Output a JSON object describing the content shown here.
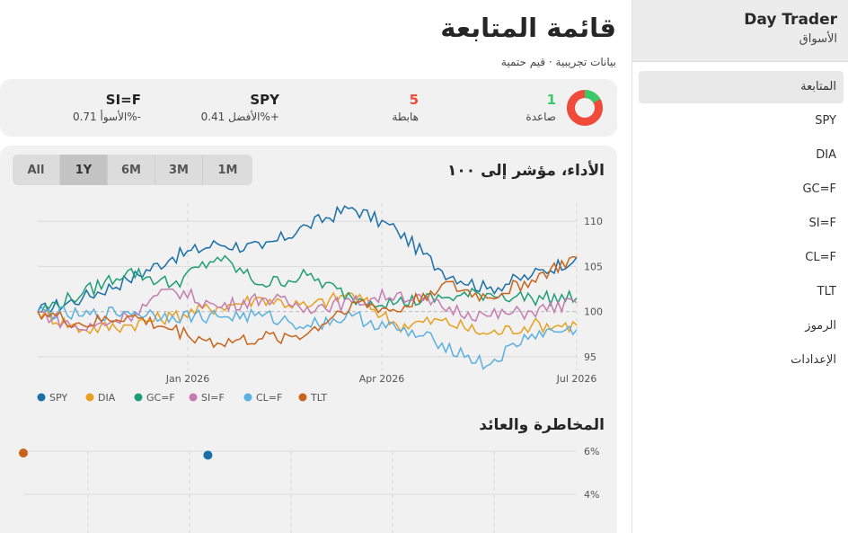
{
  "app": {
    "name": "Day Trader",
    "section": "الأسواق"
  },
  "nav": [
    {
      "label": "المتابعة",
      "active": true
    },
    {
      "label": "SPY"
    },
    {
      "label": "DIA"
    },
    {
      "label": "GC=F"
    },
    {
      "label": "SI=F"
    },
    {
      "label": "CL=F"
    },
    {
      "label": "TLT"
    },
    {
      "label": "الرموز"
    },
    {
      "label": "الإعدادات"
    }
  ],
  "page": {
    "title": "قائمة المتابعة",
    "subtitle": "بيانات تجريبية · قيم حتمية"
  },
  "summary": {
    "up": {
      "count": "1",
      "label": "صاعدة",
      "color": "#3cc96a"
    },
    "down": {
      "count": "5",
      "label": "هابطة",
      "color": "#f04a3a"
    },
    "best": {
      "symbol": "SPY",
      "label": "الأفضل 0.41%+"
    },
    "worst": {
      "symbol": "SI=F",
      "label": "الأسوأ 0.71%-"
    }
  },
  "performance": {
    "title": "الأداء، مؤشر إلى ١٠٠",
    "ranges": [
      "All",
      "1Y",
      "6M",
      "3M",
      "1M"
    ],
    "active_range": "1Y"
  },
  "risk": {
    "title": "المخاطرة والعائد",
    "y_ticks": [
      "6%",
      "4%"
    ]
  },
  "chart_data": [
    {
      "type": "line",
      "title": "الأداء، مؤشر إلى ١٠٠",
      "x_ticks": [
        "Jan 2026",
        "Apr 2026",
        "Jul 2026"
      ],
      "y_ticks": [
        95,
        100,
        105,
        110
      ],
      "ylim": [
        93.5,
        112
      ],
      "x": [
        "2025-07",
        "2025-08",
        "2025-09",
        "2025-10",
        "2025-11",
        "2025-12",
        "2026-01",
        "2026-02",
        "2026-03",
        "2026-04",
        "2026-05",
        "2026-06",
        "2026-07"
      ],
      "legend_position": "bottom-left",
      "series": [
        {
          "name": "SPY",
          "color": "#1a6fa8",
          "values": [
            100,
            101.5,
            103.5,
            106,
            107.5,
            107,
            109.5,
            111.5,
            109,
            104.5,
            102.5,
            104,
            106
          ]
        },
        {
          "name": "DIA",
          "color": "#e8a020",
          "values": [
            100,
            98,
            98.5,
            99.5,
            100.5,
            101.5,
            100.5,
            102,
            98.5,
            99,
            97.5,
            98.5,
            98.5
          ]
        },
        {
          "name": "GC=F",
          "color": "#1f9e76",
          "values": [
            100,
            102,
            104.5,
            103,
            106,
            103,
            104,
            101.5,
            101,
            101.5,
            102,
            101.5,
            101.5
          ]
        },
        {
          "name": "SI=F",
          "color": "#c67bb0",
          "values": [
            100,
            98,
            99.5,
            102.5,
            100.5,
            101.5,
            100.5,
            101,
            102,
            100.5,
            99.5,
            100,
            101
          ]
        },
        {
          "name": "CL=F",
          "color": "#5ab0e0",
          "values": [
            100,
            99.5,
            100,
            99.5,
            99.5,
            99.5,
            98.5,
            99.5,
            98,
            96.5,
            94,
            97.5,
            98
          ]
        },
        {
          "name": "TLT",
          "color": "#c8641a",
          "values": [
            100,
            98.5,
            99.5,
            98,
            96.5,
            97,
            97.5,
            101,
            100,
            103,
            101.5,
            103.5,
            106
          ]
        }
      ]
    },
    {
      "type": "scatter",
      "title": "المخاطرة والعائد",
      "y_ticks": [
        "6%",
        "4%"
      ],
      "ylim": [
        3,
        6.5
      ],
      "points": [
        {
          "name": "TLT",
          "color": "#c8641a",
          "x": 0.0,
          "y": 6.0
        },
        {
          "name": "SPY",
          "color": "#1a6fa8",
          "x": 0.5,
          "y": 5.9
        }
      ]
    }
  ]
}
